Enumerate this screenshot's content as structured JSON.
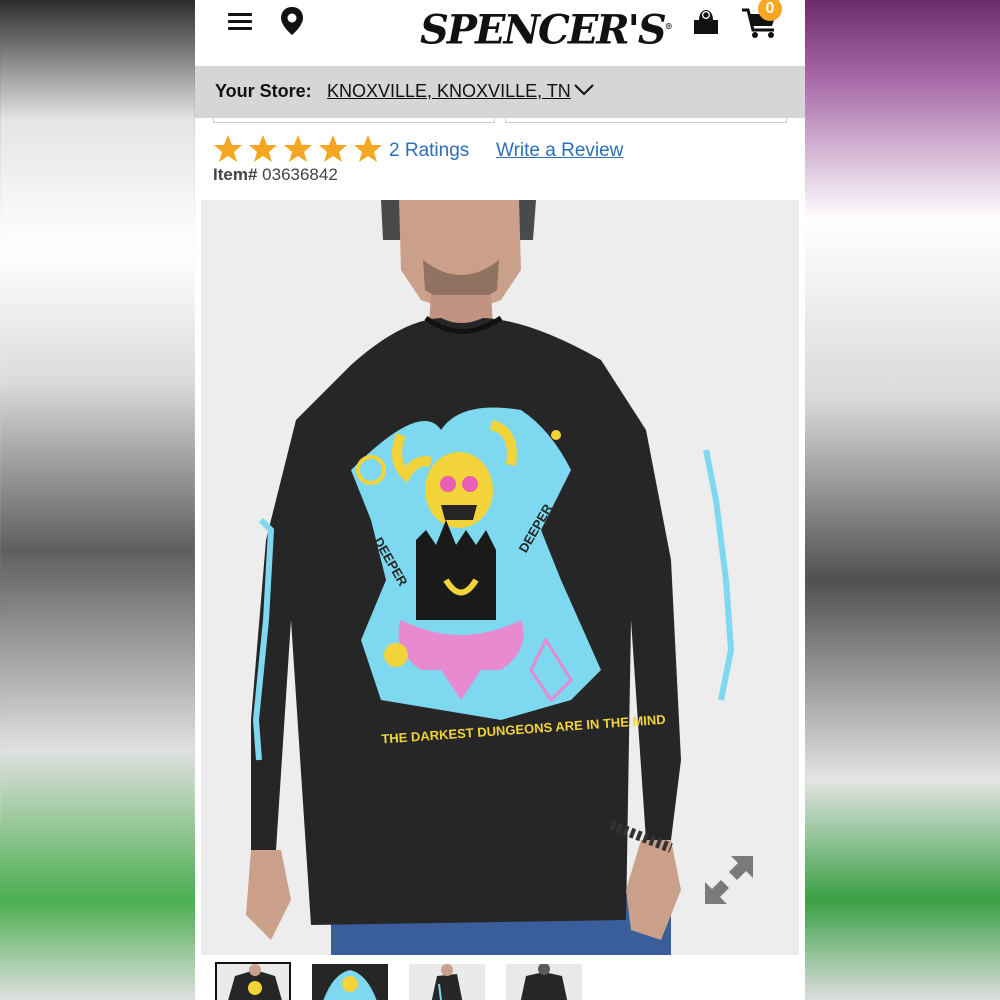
{
  "header": {
    "logo_text": "SPENCER'S",
    "cart_count": "0"
  },
  "store_bar": {
    "label": "Your Store:",
    "store_name": "KNOXVILLE, KNOXVILLE, TN"
  },
  "product": {
    "rating_stars": 5,
    "rating_max": 5,
    "ratings_link": "2 Ratings",
    "write_review": "Write a Review",
    "item_label": "Item#",
    "item_number": "03636842",
    "shirt_print_text": "THE DARKEST DUNGEONS ARE IN THE MIND",
    "sleeve_text_left": "DEEPER",
    "sleeve_text_right": "DEEPER"
  },
  "thumbnails": {
    "count": 4,
    "selected_index": 0
  },
  "colors": {
    "star": "#f5a623",
    "link": "#2a6fb8",
    "store_bar_bg": "#d6d6d6",
    "cart_badge": "#f5a623"
  },
  "icons": [
    "menu-icon",
    "location-pin-icon",
    "account-icon",
    "cart-icon",
    "chevron-down-icon",
    "star-icon",
    "expand-icon"
  ]
}
